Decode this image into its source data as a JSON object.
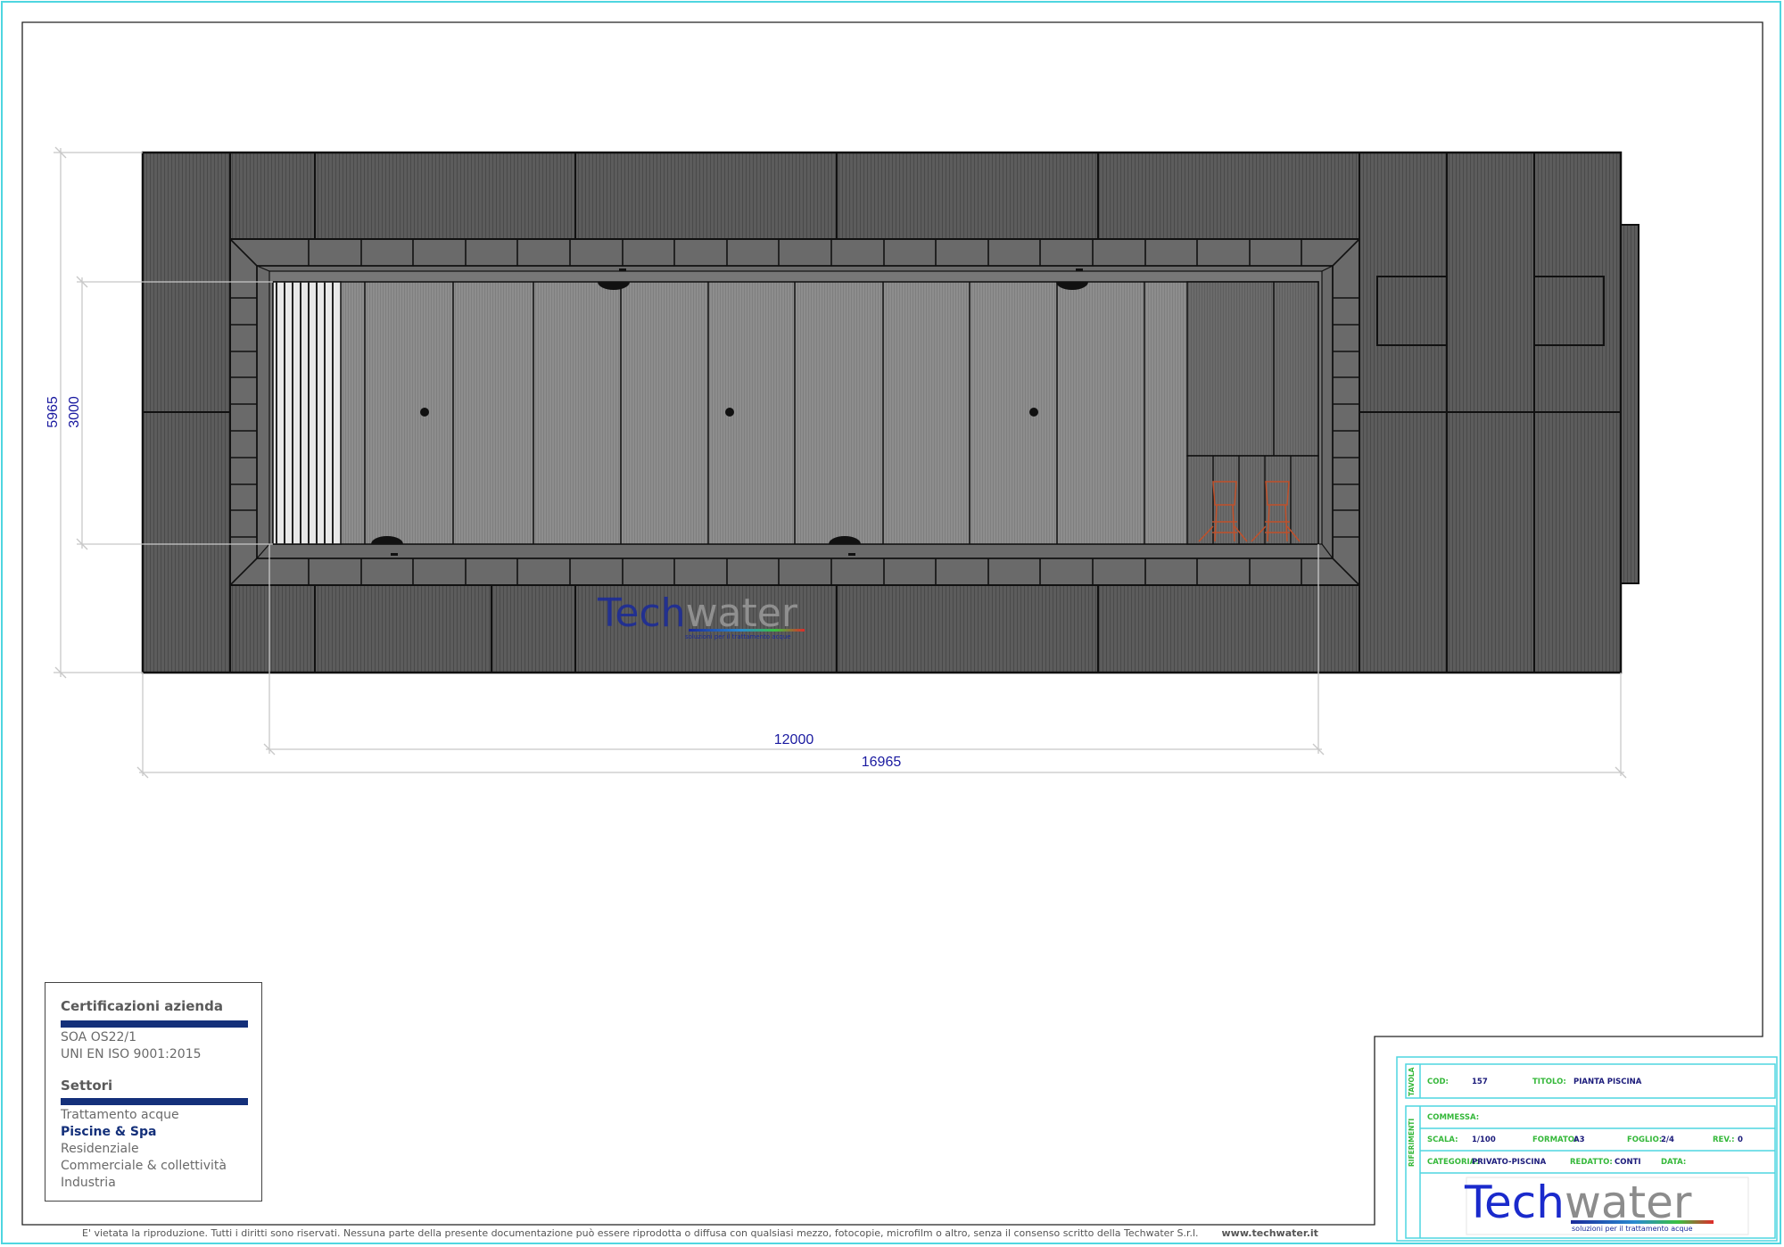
{
  "drawing": {
    "dimensions": {
      "total_length": "16965",
      "pool_length": "12000",
      "total_width": "5965",
      "pool_width": "3000"
    },
    "watermark": {
      "brand_part1": "Tech",
      "brand_part2": "water",
      "tagline": "soluzioni per il trattamento acque"
    }
  },
  "certifications": {
    "heading": "Certificazioni azienda",
    "items": [
      "SOA OS22/1",
      "UNI EN ISO 9001:2015"
    ],
    "sectors_heading": "Settori",
    "sectors": [
      {
        "label": "Trattamento acque",
        "highlighted": false
      },
      {
        "label": "Piscine & Spa",
        "highlighted": true
      },
      {
        "label": "Residenziale",
        "highlighted": false
      },
      {
        "label": "Commerciale & collettività",
        "highlighted": false
      },
      {
        "label": "Industria",
        "highlighted": false
      }
    ]
  },
  "title_block": {
    "tavola_label": "TAVOLA",
    "riferimenti_label": "RIFERIMENTI",
    "cod_label": "COD:",
    "cod_value": "157",
    "titolo_label": "TITOLO:",
    "titolo_value": "PIANTA PISCINA",
    "commessa_label": "COMMESSA:",
    "scala_label": "SCALA:",
    "scala_value": "1/100",
    "formato_label": "FORMATO:",
    "formato_value": "A3",
    "foglio_label": "FOGLIO:",
    "foglio_value": "2/4",
    "rev_label": "REV.:",
    "rev_value": "0",
    "categoria_label": "CATEGORIA:",
    "categoria_value": "PRIVATO-PISCINA",
    "redatto_label": "REDATTO:",
    "redatto_value": "CONTI",
    "data_label": "DATA:",
    "logo_part1": "Tech",
    "logo_part2": "water",
    "logo_tagline": "soluzioni per il trattamento acque"
  },
  "footer": {
    "notice": "E' vietata la riproduzione. Tutti i diritti sono riservati. Nessuna parte della presente documentazione può essere riprodotta o diffusa con qualsiasi mezzo, fotocopie, microfilm o altro, senza il consenso scritto della Techwater S.r.l.",
    "website": "www.techwater.it"
  },
  "colors": {
    "deck": "#585858",
    "pool_floor": "#8a8a8a",
    "coping": "#6d6d6d",
    "dimension_text": "#1a1aa0",
    "brand_blue": "#1a2a9a",
    "brand_gray": "#8a8a8a",
    "frame_cyan": "#4fd6e0",
    "title_green": "#35b83a",
    "ladder_orange": "#c0502a"
  },
  "icons": [
    "drain-icon",
    "pool-ladder-icon",
    "skimmer-icon"
  ]
}
